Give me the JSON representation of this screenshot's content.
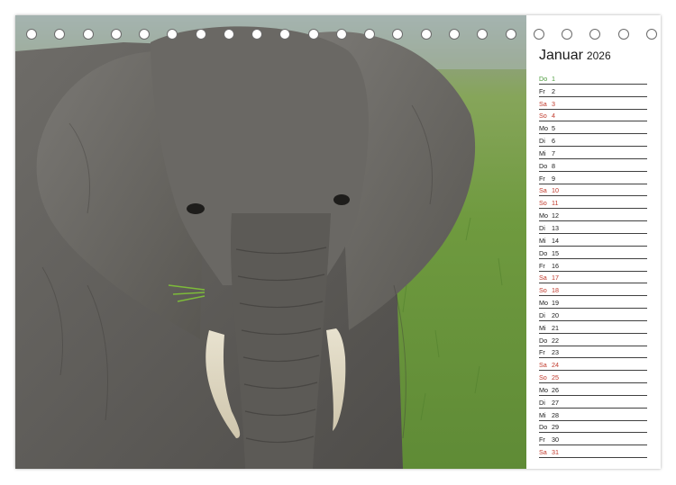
{
  "calendar": {
    "month": "Januar",
    "year": "2026",
    "colors": {
      "holiday": "#4a9a3a",
      "weekend": "#c0392b",
      "weekday": "#1a1a1a"
    },
    "days": [
      {
        "wd": "Do",
        "d": "1",
        "type": "holiday"
      },
      {
        "wd": "Fr",
        "d": "2",
        "type": "weekday"
      },
      {
        "wd": "Sa",
        "d": "3",
        "type": "weekend"
      },
      {
        "wd": "So",
        "d": "4",
        "type": "weekend"
      },
      {
        "wd": "Mo",
        "d": "5",
        "type": "weekday"
      },
      {
        "wd": "Di",
        "d": "6",
        "type": "weekday"
      },
      {
        "wd": "Mi",
        "d": "7",
        "type": "weekday"
      },
      {
        "wd": "Do",
        "d": "8",
        "type": "weekday"
      },
      {
        "wd": "Fr",
        "d": "9",
        "type": "weekday"
      },
      {
        "wd": "Sa",
        "d": "10",
        "type": "weekend"
      },
      {
        "wd": "So",
        "d": "11",
        "type": "weekend"
      },
      {
        "wd": "Mo",
        "d": "12",
        "type": "weekday"
      },
      {
        "wd": "Di",
        "d": "13",
        "type": "weekday"
      },
      {
        "wd": "Mi",
        "d": "14",
        "type": "weekday"
      },
      {
        "wd": "Do",
        "d": "15",
        "type": "weekday"
      },
      {
        "wd": "Fr",
        "d": "16",
        "type": "weekday"
      },
      {
        "wd": "Sa",
        "d": "17",
        "type": "weekend"
      },
      {
        "wd": "So",
        "d": "18",
        "type": "weekend"
      },
      {
        "wd": "Mo",
        "d": "19",
        "type": "weekday"
      },
      {
        "wd": "Di",
        "d": "20",
        "type": "weekday"
      },
      {
        "wd": "Mi",
        "d": "21",
        "type": "weekday"
      },
      {
        "wd": "Do",
        "d": "22",
        "type": "weekday"
      },
      {
        "wd": "Fr",
        "d": "23",
        "type": "weekday"
      },
      {
        "wd": "Sa",
        "d": "24",
        "type": "weekend"
      },
      {
        "wd": "So",
        "d": "25",
        "type": "weekend"
      },
      {
        "wd": "Mo",
        "d": "26",
        "type": "weekday"
      },
      {
        "wd": "Di",
        "d": "27",
        "type": "weekday"
      },
      {
        "wd": "Mi",
        "d": "28",
        "type": "weekday"
      },
      {
        "wd": "Do",
        "d": "29",
        "type": "weekday"
      },
      {
        "wd": "Fr",
        "d": "30",
        "type": "weekday"
      },
      {
        "wd": "Sa",
        "d": "31",
        "type": "weekend"
      }
    ]
  },
  "photo": {
    "subject": "elephant"
  },
  "binding": {
    "ring_count": 23,
    "icon": "spiral-binding-ring-icon"
  }
}
